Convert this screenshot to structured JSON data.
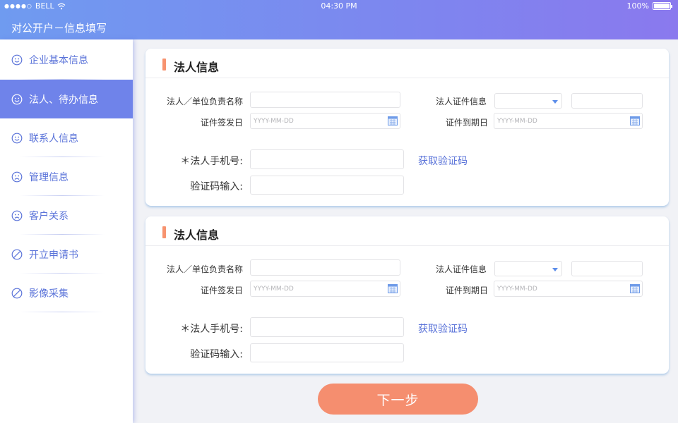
{
  "status_bar": {
    "carrier": "BELL",
    "signal": "●●●●○",
    "time": "04:30 PM",
    "battery": "100%"
  },
  "header": {
    "title": "对公开户－信息填写"
  },
  "sidebar": {
    "items": [
      {
        "label": "企业基本信息",
        "icon": "smile-icon",
        "active": false
      },
      {
        "label": "法人、待办信息",
        "icon": "smile-icon",
        "active": true
      },
      {
        "label": "联系人信息",
        "icon": "smile-icon",
        "active": false
      },
      {
        "label": "管理信息",
        "icon": "frown-icon",
        "active": false
      },
      {
        "label": "客户关系",
        "icon": "frown-icon",
        "active": false
      },
      {
        "label": "开立申请书",
        "icon": "forbidden-icon",
        "active": false
      },
      {
        "label": "影像采集",
        "icon": "forbidden-icon",
        "active": false
      }
    ]
  },
  "sections": [
    {
      "title": "法人信息",
      "labels": {
        "name": "法人／单位负责名称",
        "cert_info": "法人证件信息",
        "issue_date": "证件签发日",
        "expiry_date": "证件到期日",
        "phone": "＊法人手机号:",
        "code_input": "验证码输入:"
      },
      "date_placeholder": "YYYY-MM-DD",
      "get_code": "获取验证码"
    },
    {
      "title": "法人信息",
      "labels": {
        "name": "法人／单位负责名称",
        "cert_info": "法人证件信息",
        "issue_date": "证件签发日",
        "expiry_date": "证件到期日",
        "phone": "＊法人手机号:",
        "code_input": "验证码输入:"
      },
      "date_placeholder": "YYYY-MM-DD",
      "get_code": "获取验证码"
    }
  ],
  "actions": {
    "next": "下一步"
  },
  "colors": {
    "accent": "#6f83ea",
    "primary_button": "#f58e6f",
    "link": "#5a73d9"
  }
}
